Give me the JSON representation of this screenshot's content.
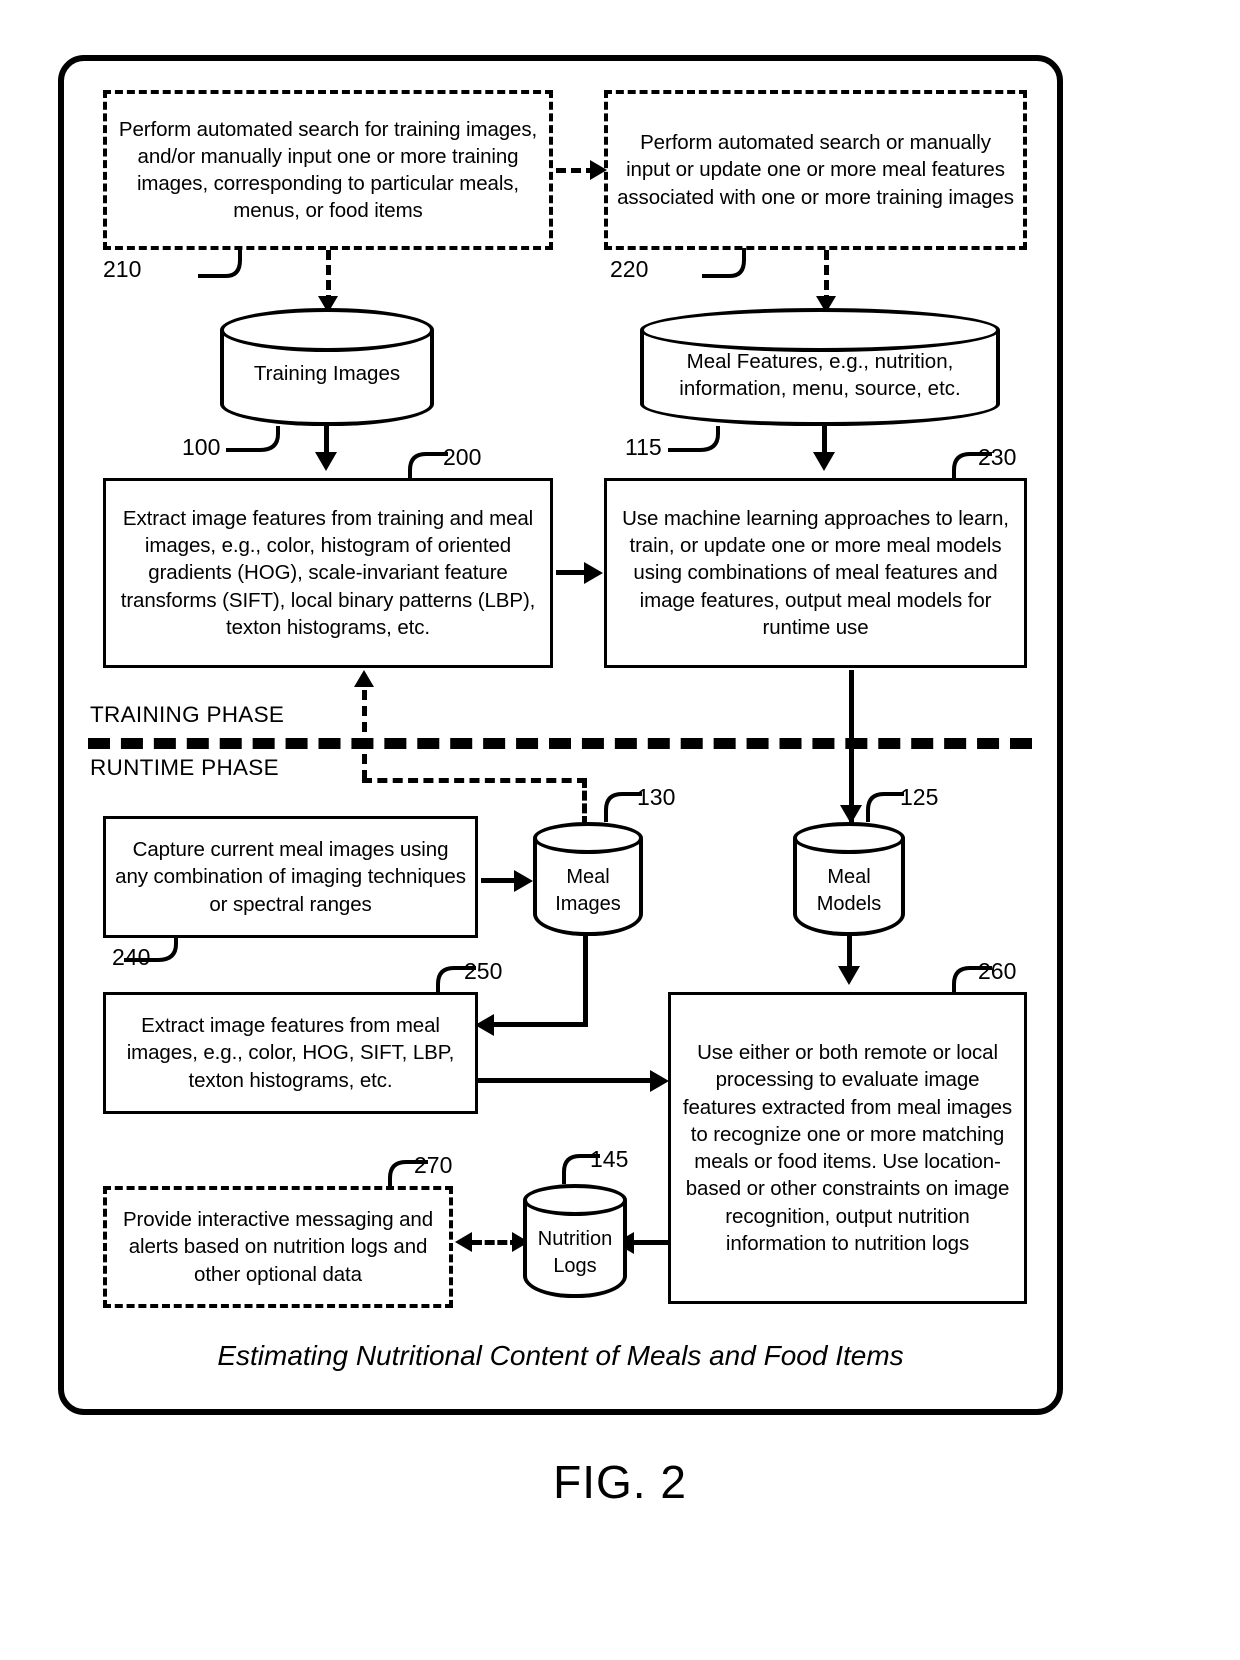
{
  "figure": {
    "number_label": "FIG. 2",
    "caption": "Estimating Nutritional Content of Meals and Food Items"
  },
  "phases": {
    "training_label": "TRAINING PHASE",
    "runtime_label": "RUNTIME PHASE"
  },
  "nodes": {
    "n210": {
      "ref": "210",
      "style": "dashed",
      "text": "Perform automated search for training images, and/or manually input one or more training images, corresponding to particular meals, menus, or food items"
    },
    "n220": {
      "ref": "220",
      "style": "dashed",
      "text": "Perform automated search or manually input or update one or more meal features associated with one or more training images"
    },
    "n100": {
      "ref": "100",
      "style": "cylinder",
      "text": "Training Images"
    },
    "n115": {
      "ref": "115",
      "style": "cylinder",
      "text": "Meal Features, e.g., nutrition, information, menu, source, etc."
    },
    "n200": {
      "ref": "200",
      "style": "solid",
      "text": "Extract image features from training and meal images, e.g., color, histogram of oriented gradients (HOG), scale-invariant feature transforms (SIFT), local binary patterns (LBP), texton histograms, etc."
    },
    "n230": {
      "ref": "230",
      "style": "solid",
      "text": "Use machine learning approaches to learn, train, or update one or more meal models using combinations of meal features and image features, output meal models for runtime use"
    },
    "n240": {
      "ref": "240",
      "style": "solid",
      "text": "Capture current meal images using any combination of imaging techniques or spectral ranges"
    },
    "n130": {
      "ref": "130",
      "style": "cylinder",
      "text": "Meal Images"
    },
    "n125": {
      "ref": "125",
      "style": "cylinder",
      "text": "Meal Models"
    },
    "n250": {
      "ref": "250",
      "style": "solid",
      "text": "Extract image features from meal images, e.g., color, HOG, SIFT, LBP, texton histograms, etc."
    },
    "n260": {
      "ref": "260",
      "style": "solid",
      "text": "Use either or both remote or local processing to evaluate image features extracted from meal images to recognize one or more matching meals or food items. Use location-based or other constraints on image recognition, output nutrition information to nutrition logs"
    },
    "n270": {
      "ref": "270",
      "style": "dashed",
      "text": "Provide interactive messaging and alerts based on nutrition logs and other optional data"
    },
    "n145": {
      "ref": "145",
      "style": "cylinder",
      "text": "Nutrition Logs"
    }
  },
  "colors": {
    "stroke": "#000000",
    "background": "#ffffff"
  }
}
